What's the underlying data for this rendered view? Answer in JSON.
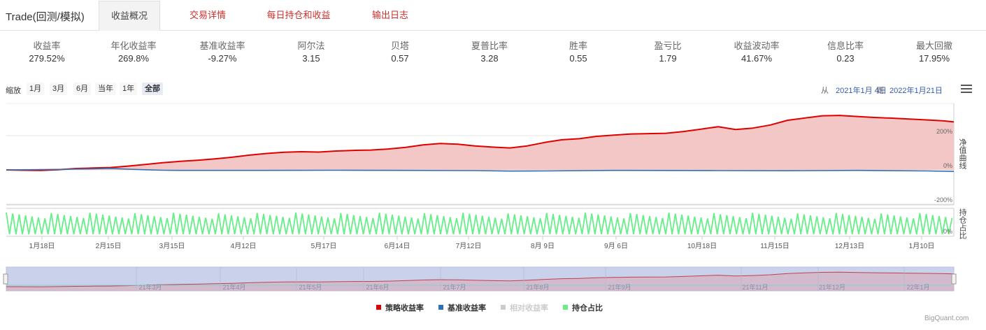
{
  "app_title": "Trade(回测/模拟)",
  "tabs": [
    {
      "label": "收益概况",
      "active": true
    },
    {
      "label": "交易详情",
      "active": false
    },
    {
      "label": "每日持仓和收益",
      "active": false
    },
    {
      "label": "输出日志",
      "active": false
    }
  ],
  "stats": [
    {
      "label": "收益率",
      "value": "279.52%"
    },
    {
      "label": "年化收益率",
      "value": "269.8%"
    },
    {
      "label": "基准收益率",
      "value": "-9.27%"
    },
    {
      "label": "阿尔法",
      "value": "3.15"
    },
    {
      "label": "贝塔",
      "value": "0.57"
    },
    {
      "label": "夏普比率",
      "value": "3.28"
    },
    {
      "label": "胜率",
      "value": "0.55"
    },
    {
      "label": "盈亏比",
      "value": "1.79"
    },
    {
      "label": "收益波动率",
      "value": "41.67%"
    },
    {
      "label": "信息比率",
      "value": "0.23"
    },
    {
      "label": "最大回撤",
      "value": "17.95%"
    }
  ],
  "zoom": {
    "label": "缩放",
    "buttons": [
      "1月",
      "3月",
      "6月",
      "当年",
      "1年",
      "全部"
    ],
    "active": "全部"
  },
  "range": {
    "from_label": "从",
    "from": "2021年1月 4日",
    "to_label": "到",
    "to": "2022年1月21日"
  },
  "chart_data": {
    "type": "area",
    "panels": [
      {
        "name": "净值曲线",
        "yticks": [
          "200%",
          "0%",
          "-200%"
        ]
      },
      {
        "name": "持仓占比",
        "yticks": [
          "0%"
        ]
      }
    ],
    "x_ticks": [
      "1月18日",
      "2月15日",
      "3月15日",
      "4月12日",
      "5月17日",
      "6月14日",
      "7月12日",
      "8月 9日",
      "9月 6日",
      "10月18日",
      "11月15日",
      "12月13日",
      "1月10日"
    ],
    "navigator_labels": [
      "21年3月",
      "21年4月",
      "21年5月",
      "21年6月",
      "21年7月",
      "21年8月",
      "21年9月",
      "21年11月",
      "21年12月",
      "22年1月"
    ],
    "ylim": [
      -200,
      400
    ],
    "series": [
      {
        "name": "策略收益率",
        "color": "#e00000",
        "visible": true,
        "points": [
          [
            "2021-01-04",
            0
          ],
          [
            "2021-01-11",
            -2
          ],
          [
            "2021-01-18",
            -3
          ],
          [
            "2021-01-25",
            1
          ],
          [
            "2021-02-01",
            8
          ],
          [
            "2021-02-08",
            11
          ],
          [
            "2021-02-15",
            14
          ],
          [
            "2021-02-22",
            22
          ],
          [
            "2021-03-01",
            32
          ],
          [
            "2021-03-08",
            42
          ],
          [
            "2021-03-15",
            50
          ],
          [
            "2021-03-22",
            56
          ],
          [
            "2021-03-29",
            64
          ],
          [
            "2021-04-05",
            74
          ],
          [
            "2021-04-12",
            86
          ],
          [
            "2021-04-19",
            96
          ],
          [
            "2021-04-26",
            103
          ],
          [
            "2021-05-03",
            106
          ],
          [
            "2021-05-10",
            104
          ],
          [
            "2021-05-17",
            110
          ],
          [
            "2021-05-24",
            114
          ],
          [
            "2021-05-31",
            116
          ],
          [
            "2021-06-07",
            122
          ],
          [
            "2021-06-14",
            132
          ],
          [
            "2021-06-21",
            146
          ],
          [
            "2021-06-28",
            154
          ],
          [
            "2021-07-05",
            150
          ],
          [
            "2021-07-12",
            140
          ],
          [
            "2021-07-19",
            133
          ],
          [
            "2021-07-26",
            128
          ],
          [
            "2021-08-02",
            140
          ],
          [
            "2021-08-09",
            160
          ],
          [
            "2021-08-16",
            176
          ],
          [
            "2021-08-23",
            182
          ],
          [
            "2021-08-30",
            196
          ],
          [
            "2021-09-06",
            203
          ],
          [
            "2021-09-13",
            210
          ],
          [
            "2021-09-20",
            212
          ],
          [
            "2021-09-27",
            214
          ],
          [
            "2021-10-04",
            224
          ],
          [
            "2021-10-11",
            238
          ],
          [
            "2021-10-18",
            252
          ],
          [
            "2021-10-25",
            236
          ],
          [
            "2021-11-01",
            244
          ],
          [
            "2021-11-08",
            262
          ],
          [
            "2021-11-15",
            290
          ],
          [
            "2021-11-22",
            303
          ],
          [
            "2021-11-29",
            316
          ],
          [
            "2021-12-06",
            318
          ],
          [
            "2021-12-13",
            312
          ],
          [
            "2021-12-20",
            306
          ],
          [
            "2021-12-27",
            302
          ],
          [
            "2022-01-03",
            297
          ],
          [
            "2022-01-10",
            292
          ],
          [
            "2022-01-17",
            286
          ],
          [
            "2022-01-21",
            280
          ]
        ]
      },
      {
        "name": "基准收益率",
        "color": "#2f6fb5",
        "visible": true,
        "points": [
          [
            "2021-01-04",
            0
          ],
          [
            "2021-01-11",
            1
          ],
          [
            "2021-01-18",
            2
          ],
          [
            "2021-01-25",
            3
          ],
          [
            "2021-02-01",
            5
          ],
          [
            "2021-02-08",
            6
          ],
          [
            "2021-02-15",
            9
          ],
          [
            "2021-02-22",
            4
          ],
          [
            "2021-03-01",
            1
          ],
          [
            "2021-03-08",
            -2
          ],
          [
            "2021-03-15",
            -3
          ],
          [
            "2021-04-12",
            -3
          ],
          [
            "2021-05-17",
            -2
          ],
          [
            "2021-06-14",
            -3
          ],
          [
            "2021-07-12",
            -4
          ],
          [
            "2021-07-26",
            -7
          ],
          [
            "2021-08-09",
            -6
          ],
          [
            "2021-09-06",
            -3
          ],
          [
            "2021-10-18",
            -4
          ],
          [
            "2021-11-15",
            -5
          ],
          [
            "2021-12-13",
            -3
          ],
          [
            "2022-01-10",
            -6
          ],
          [
            "2022-01-21",
            -9
          ]
        ]
      },
      {
        "name": "相对收益率",
        "color": "#cccccc",
        "visible": false,
        "points": []
      },
      {
        "name": "持仓占比",
        "color": "#66ee88",
        "visible": true,
        "points": [
          [
            "2021-01-04",
            1
          ],
          [
            "2021-01-21",
            1
          ],
          [
            "2021-02-15",
            1
          ],
          [
            "2021-03-15",
            1
          ],
          [
            "2021-04-12",
            1
          ],
          [
            "2021-05-17",
            1
          ],
          [
            "2021-06-14",
            1
          ],
          [
            "2021-07-12",
            1
          ],
          [
            "2021-08-09",
            1
          ],
          [
            "2021-09-06",
            1
          ],
          [
            "2021-10-18",
            1
          ],
          [
            "2021-11-15",
            1
          ],
          [
            "2021-12-13",
            1
          ],
          [
            "2022-01-10",
            1
          ],
          [
            "2022-01-21",
            1
          ]
        ]
      }
    ]
  },
  "credits": "BigQuant.com",
  "colors": {
    "strategy": "#e00000",
    "strategy_fill": "#f4c7c7",
    "benchmark": "#2f6fb5",
    "position": "#66ee88",
    "navigator": "#c9d2ea"
  }
}
